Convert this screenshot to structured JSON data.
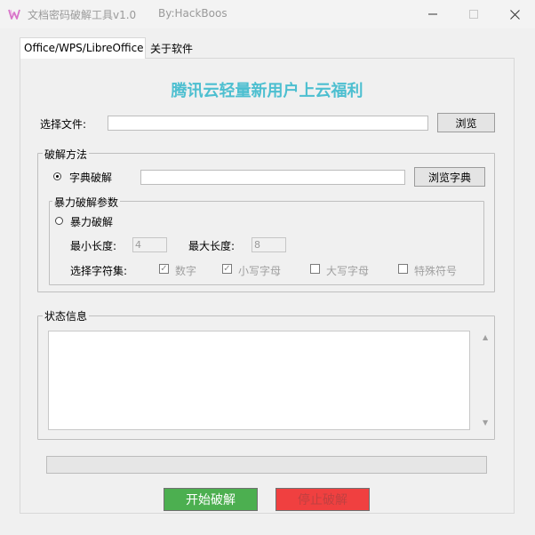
{
  "window": {
    "title": "文档密码破解工具v1.0",
    "author": "By:HackBoos",
    "icon": "w-logo-icon",
    "controls": {
      "minimize": "—",
      "maximize": "☐",
      "close": "✕"
    }
  },
  "tabs": [
    {
      "label": "Office/WPS/LibreOffice",
      "active": true
    },
    {
      "label": "关于软件",
      "active": false
    }
  ],
  "promo": {
    "text": "腾讯云轻量新用户上云福利",
    "color": "#4dbfd0"
  },
  "file": {
    "label": "选择文件:",
    "value": "",
    "browse_label": "浏览"
  },
  "method": {
    "legend": "破解方法",
    "dictionary": {
      "label": "字典破解",
      "selected": true,
      "value": "",
      "browse_label": "浏览字典"
    },
    "brute": {
      "legend": "暴力破解参数",
      "label": "暴力破解",
      "selected": false,
      "min_length_label": "最小长度:",
      "min_length": "4",
      "max_length_label": "最大长度:",
      "max_length": "8",
      "charset_label": "选择字符集:",
      "charsets": [
        {
          "label": "数字",
          "checked": true
        },
        {
          "label": "小写字母",
          "checked": true
        },
        {
          "label": "大写字母",
          "checked": false
        },
        {
          "label": "特殊符号",
          "checked": false
        }
      ]
    }
  },
  "status": {
    "legend": "状态信息",
    "text": "",
    "scroll_up": "▲",
    "scroll_down": "▼"
  },
  "progress": {
    "value": 0
  },
  "actions": {
    "start_label": "开始破解",
    "start_color": "#4caf50",
    "stop_label": "停止破解",
    "stop_color": "#f04040"
  }
}
